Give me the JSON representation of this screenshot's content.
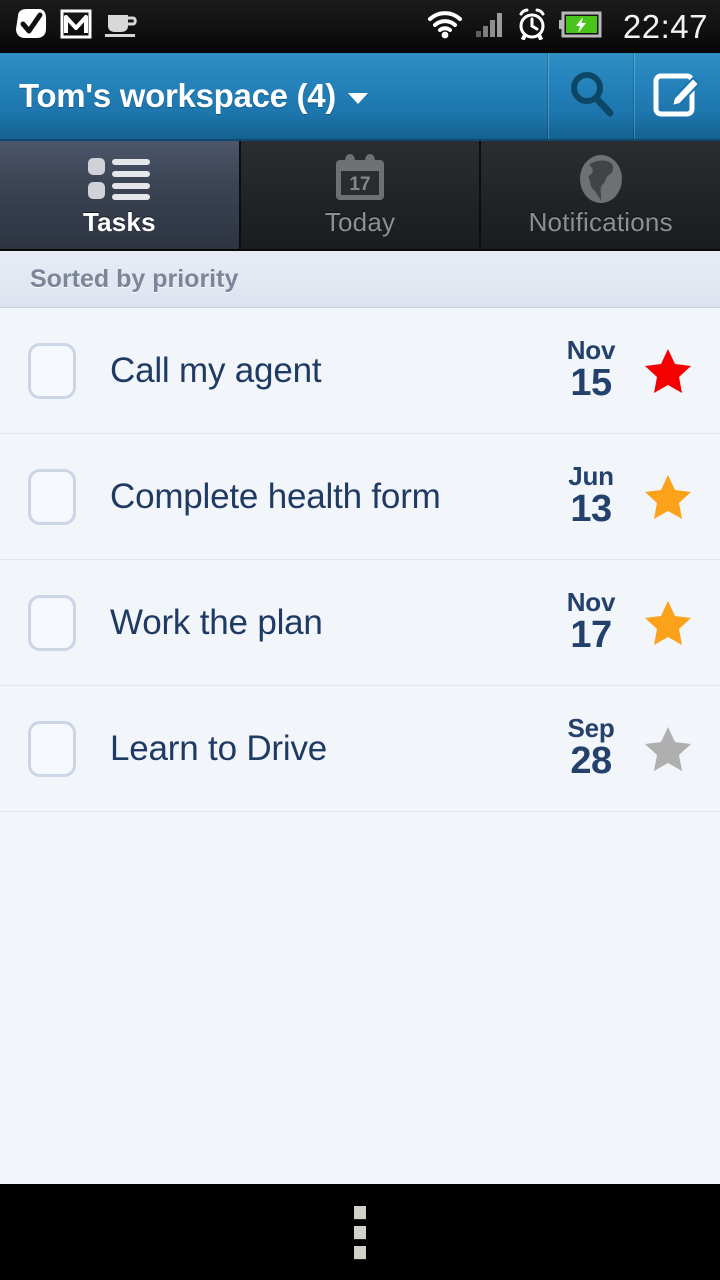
{
  "statusbar": {
    "clock": "22:47",
    "left_icons": [
      {
        "name": "checkmark-app-icon",
        "glyph": "check"
      },
      {
        "name": "gmail-icon",
        "glyph": "M"
      },
      {
        "name": "coffee-cup-icon",
        "glyph": "cup"
      }
    ],
    "right_icons": [
      {
        "name": "wifi-icon"
      },
      {
        "name": "cellular-signal-icon"
      },
      {
        "name": "alarm-clock-icon"
      },
      {
        "name": "battery-charging-icon"
      }
    ]
  },
  "appbar": {
    "title": "Tom's workspace (4)",
    "dropdown_caret": "▾",
    "search_label": "Search",
    "compose_label": "New task",
    "background_color": "#1d76ad"
  },
  "tabs": [
    {
      "label": "Tasks",
      "icon": "list-icon",
      "active": true
    },
    {
      "label": "Today",
      "icon": "calendar-icon",
      "calendar_day": "17",
      "active": false
    },
    {
      "label": "Notifications",
      "icon": "globe-icon",
      "active": false
    }
  ],
  "sortbar": {
    "text": "Sorted by priority"
  },
  "tasks": [
    {
      "title": "Call my agent",
      "month": "Nov",
      "day": "15",
      "star_color": "#F40000",
      "priority": "high",
      "checked": false
    },
    {
      "title": "Complete health form",
      "month": "Jun",
      "day": "13",
      "star_color": "#FCA11A",
      "priority": "medium",
      "checked": false
    },
    {
      "title": "Work the plan",
      "month": "Nov",
      "day": "17",
      "star_color": "#FCA11A",
      "priority": "medium",
      "checked": false
    },
    {
      "title": "Learn to Drive",
      "month": "Sep",
      "day": "28",
      "star_color": "#AFAFAF",
      "priority": "none",
      "checked": false
    }
  ],
  "navbar": {
    "overflow_label": "Menu"
  },
  "colors": {
    "accent": "#1d76ad",
    "list_bg": "#F2F5FA",
    "text_dark": "#1f3a63",
    "date_text": "#24416B"
  }
}
